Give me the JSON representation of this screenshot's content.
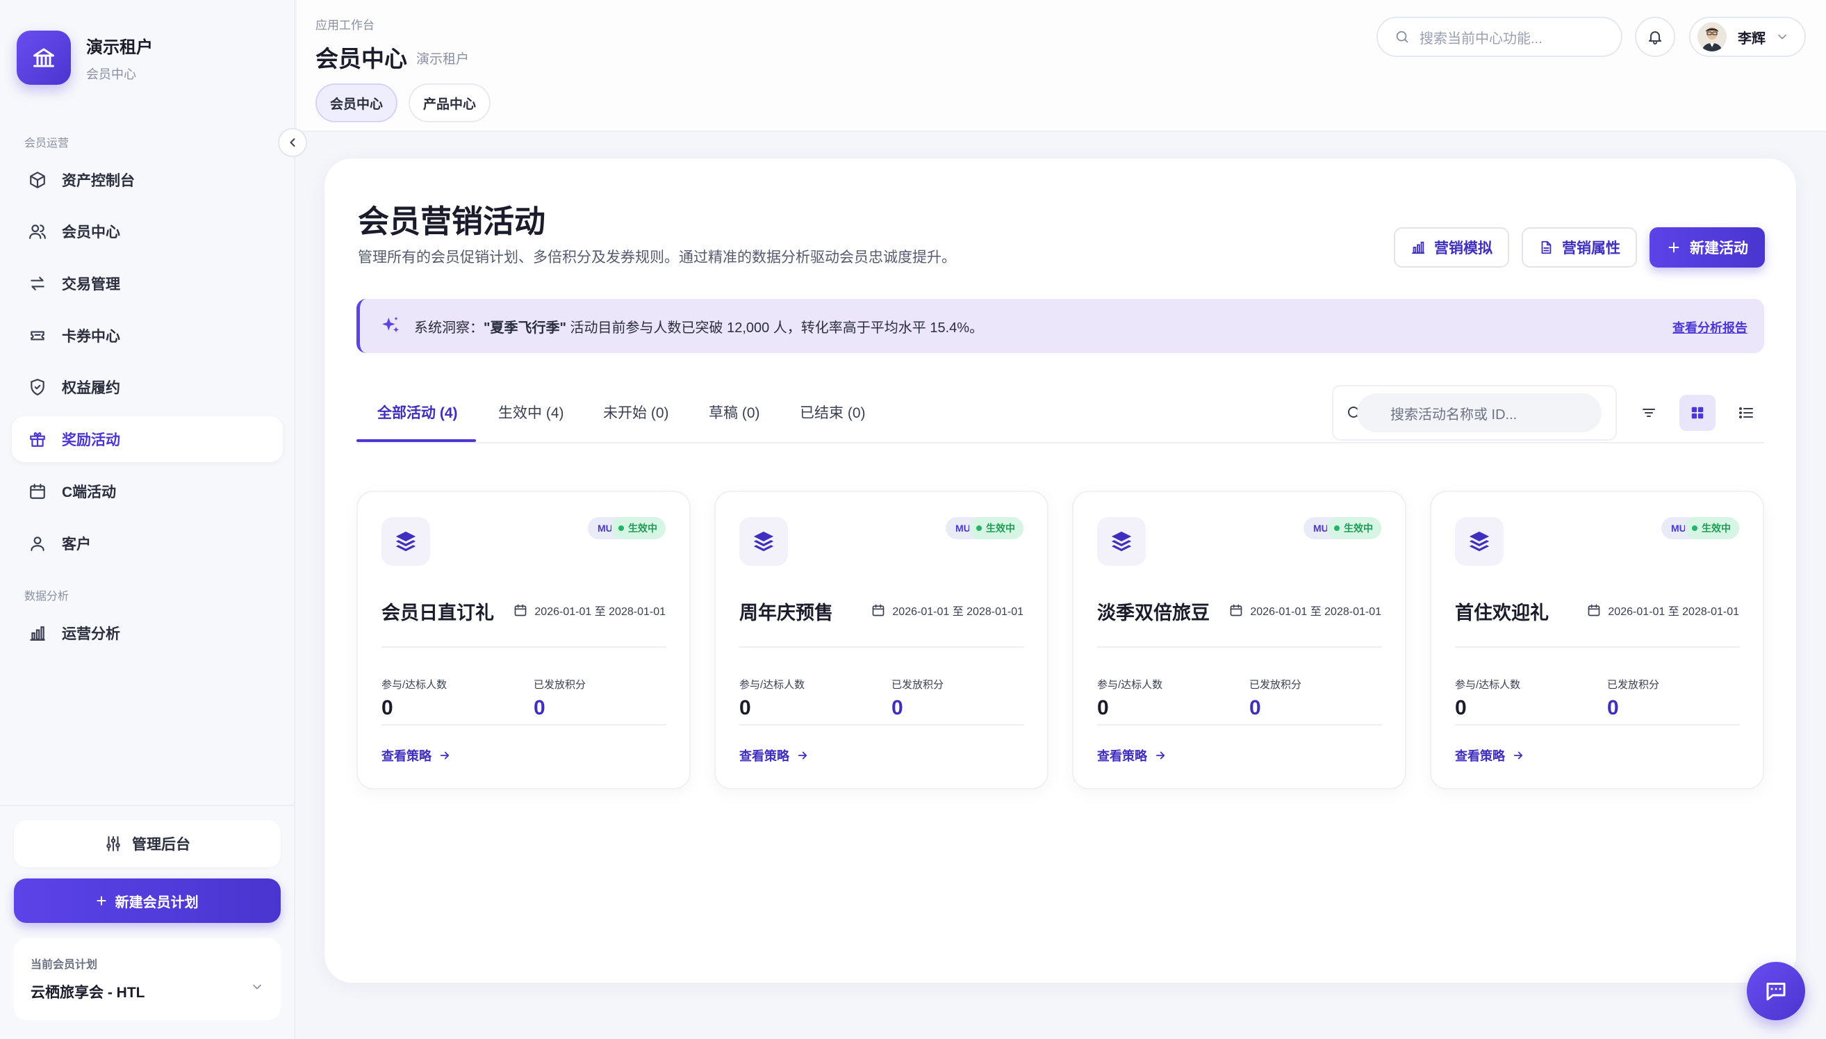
{
  "brand": {
    "title": "演示租户",
    "subtitle": "会员中心",
    "logo_icon": "bank-icon"
  },
  "sidebar": {
    "section1": "会员运营",
    "section2": "数据分析",
    "items": [
      {
        "label": "资产控制台",
        "icon": "cube-icon"
      },
      {
        "label": "会员中心",
        "icon": "users-icon"
      },
      {
        "label": "交易管理",
        "icon": "swap-icon"
      },
      {
        "label": "卡券中心",
        "icon": "ticket-icon"
      },
      {
        "label": "权益履约",
        "icon": "shield-check-icon"
      },
      {
        "label": "奖励活动",
        "icon": "gift-icon",
        "active": true
      },
      {
        "label": "C端活动",
        "icon": "calendar-icon"
      },
      {
        "label": "客户",
        "icon": "user-icon"
      },
      {
        "label": "运营分析",
        "icon": "bar-chart-icon"
      }
    ],
    "admin_label": "管理后台",
    "new_plan_label": "新建会员计划",
    "plan_label": "当前会员计划",
    "plan_value": "云栖旅享会 - HTL"
  },
  "header": {
    "crumb": "应用工作台",
    "title": "会员中心",
    "title_sub": "演示租户",
    "tabs": [
      {
        "label": "会员中心",
        "active": true
      },
      {
        "label": "产品中心",
        "active": false
      }
    ],
    "search_placeholder": "搜索当前中心功能...",
    "user_name": "李辉"
  },
  "main": {
    "title": "会员营销活动",
    "description": "管理所有的会员促销计划、多倍积分及发券规则。通过精准的数据分析驱动会员忠诚度提升。",
    "btn_simulate": "营销模拟",
    "btn_attrs": "营销属性",
    "btn_new": "新建活动",
    "insight_prefix": "系统洞察：",
    "insight_highlight": "\"夏季飞行季\"",
    "insight_rest": " 活动目前参与人数已突破 12,000 人，转化率高于平均水平 15.4%。",
    "insight_link": "查看分析报告",
    "filter_tabs": [
      "全部活动 (4)",
      "生效中 (4)",
      "未开始 (0)",
      "草稿 (0)",
      "已结束 (0)"
    ],
    "activity_search_placeholder": "搜索活动名称或 ID...",
    "colors": {
      "accent": "#4b36d6",
      "active_green": "#22b566"
    }
  },
  "cards": [
    {
      "name": "会员日直订礼",
      "date": "2026-01-01 至 2028-01-01",
      "type": "MULTI",
      "status": "生效中",
      "label1": "参与/达标人数",
      "value1": "0",
      "label2": "已发放积分",
      "value2": "0",
      "link": "查看策略"
    },
    {
      "name": "周年庆预售",
      "date": "2026-01-01 至 2028-01-01",
      "type": "MULTI",
      "status": "生效中",
      "label1": "参与/达标人数",
      "value1": "0",
      "label2": "已发放积分",
      "value2": "0",
      "link": "查看策略"
    },
    {
      "name": "淡季双倍旅豆",
      "date": "2026-01-01 至 2028-01-01",
      "type": "MULTI",
      "status": "生效中",
      "label1": "参与/达标人数",
      "value1": "0",
      "label2": "已发放积分",
      "value2": "0",
      "link": "查看策略"
    },
    {
      "name": "首住欢迎礼",
      "date": "2026-01-01 至 2028-01-01",
      "type": "MULTI",
      "status": "生效中",
      "label1": "参与/达标人数",
      "value1": "0",
      "label2": "已发放积分",
      "value2": "0",
      "link": "查看策略"
    }
  ]
}
